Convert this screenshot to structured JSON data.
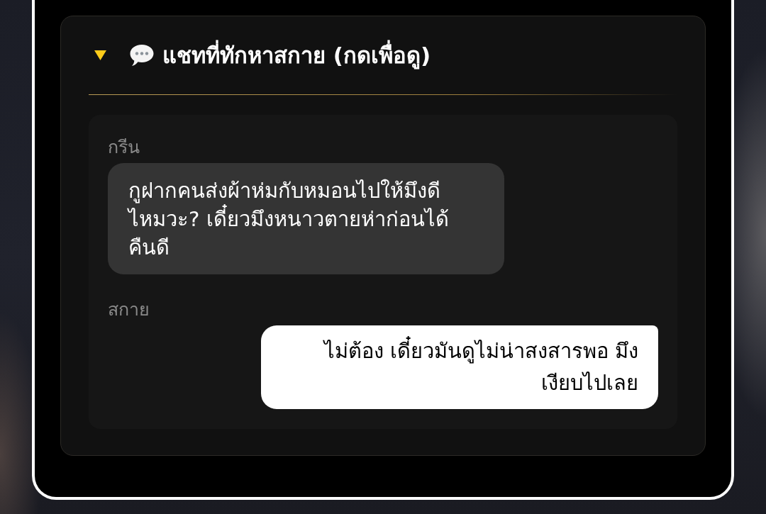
{
  "section": {
    "title": "แชทที่ทักหาสกาย (กดเพื่อดู)",
    "expanded": true,
    "messages": [
      {
        "kind": "incoming",
        "sender": "กรีน",
        "text": "กูฝากคนส่งผ้าห่มกับหมอนไปให้มึงดีไหมวะ? เดี๋ยวมึงหนาวตายห่าก่อนได้คืนดี"
      },
      {
        "kind": "outgoing",
        "sender": "สกาย",
        "text": "ไม่ต้อง เดี๋ยวมันดูไม่น่าสงสารพอ มึงเงียบไปเลย"
      }
    ]
  }
}
